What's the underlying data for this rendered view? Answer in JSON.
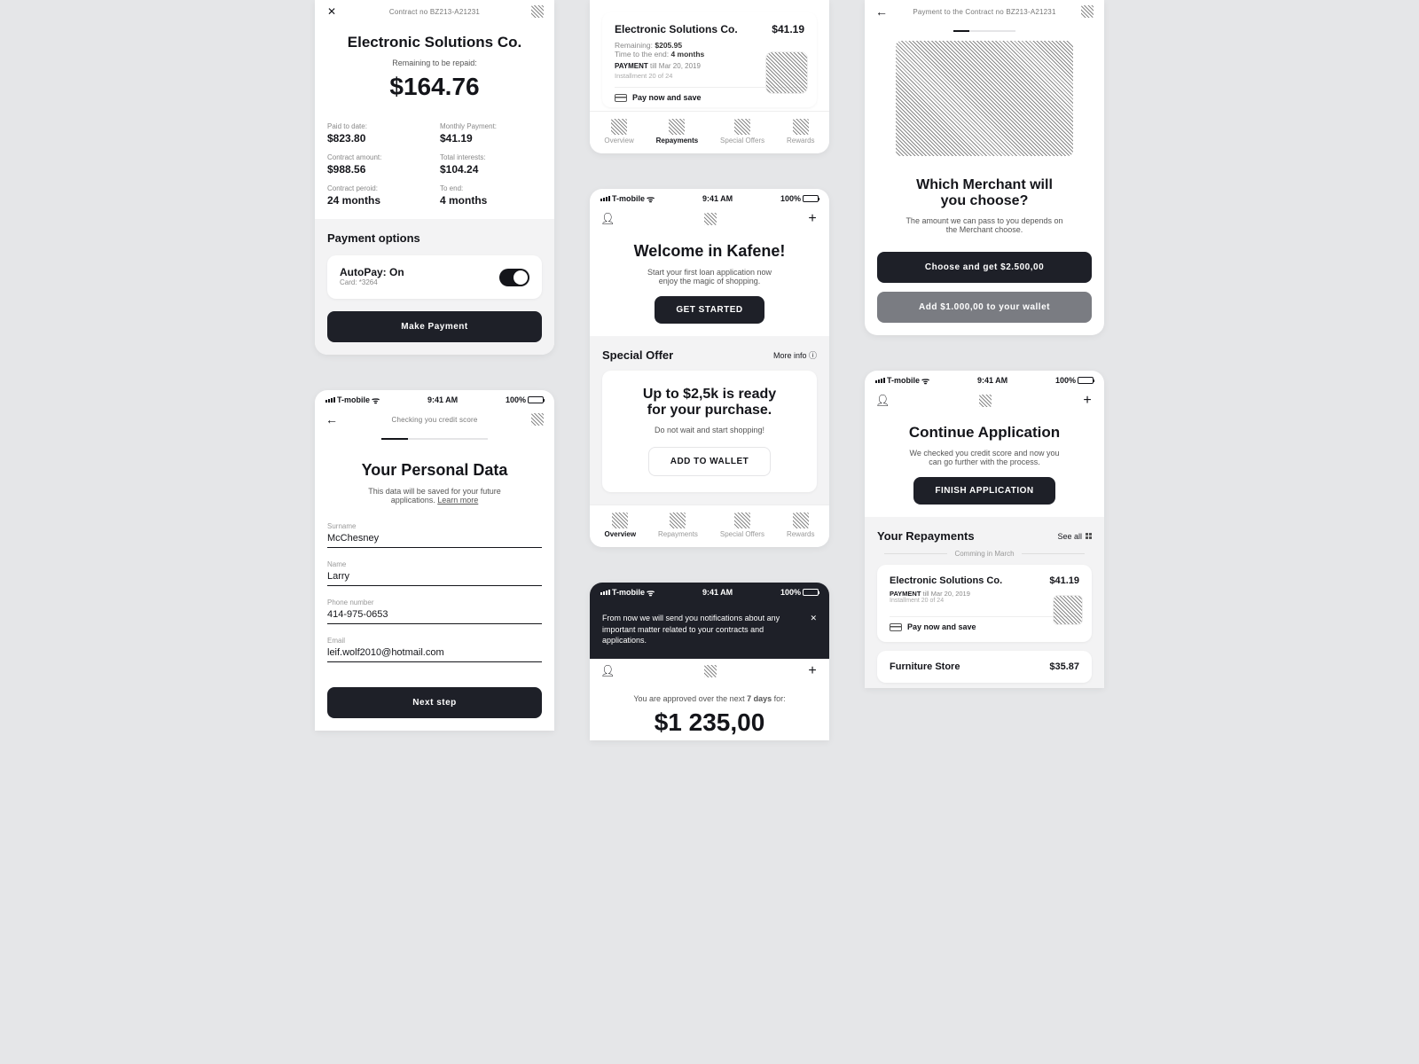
{
  "status": {
    "carrier": "T-mobile",
    "time": "9:41 AM",
    "battery": "100%"
  },
  "s1": {
    "contract_no": "Contract no BZ213-A21231",
    "company": "Electronic Solutions Co.",
    "remaining_label": "Remaining to be repaid:",
    "remaining": "$164.76",
    "stats": {
      "paid_label": "Paid to date:",
      "paid": "$823.80",
      "monthly_label": "Monthly Payment:",
      "monthly": "$41.19",
      "amount_label": "Contract amount:",
      "amount": "$988.56",
      "interest_label": "Total interests:",
      "interest": "$104.24",
      "period_label": "Contract peroid:",
      "period": "24 months",
      "toend_label": "To end:",
      "toend": "4 months"
    },
    "options_title": "Payment options",
    "autopay": "AutoPay: On",
    "card": "Card: *3264",
    "make_payment": "Make Payment"
  },
  "s2": {
    "topbar": "Checking you credit score",
    "title": "Your Personal Data",
    "sub_a": "This data will be saved for your future",
    "sub_b": "applications. ",
    "learn": "Learn more",
    "surname_l": "Surname",
    "surname": "McChesney",
    "name_l": "Name",
    "name": "Larry",
    "phone_l": "Phone number",
    "phone": "414-975-0653",
    "email_l": "Email",
    "email": "leif.wolf2010@hotmail.com",
    "next": "Next step"
  },
  "s3": {
    "company": "Electronic Solutions Co.",
    "amt": "$41.19",
    "rem": "Remaining: ",
    "rem_v": "$205.95",
    "tte": "Time to the end: ",
    "tte_v": "4 months",
    "pay": "PAYMENT ",
    "pay_v": "till Mar 20, 2019",
    "inst": "Installment 20 of 24",
    "paynow": "Pay now and save"
  },
  "tabs": {
    "overview": "Overview",
    "repay": "Repayments",
    "offers": "Special Offers",
    "rewards": "Rewards"
  },
  "s4": {
    "welcome": "Welcome in Kafene!",
    "l1": "Start your first loan application now",
    "l2": "enjoy the magic of shopping.",
    "get_started": "GET STARTED",
    "offer_title": "Special Offer",
    "more": "More info",
    "offer_h1": "Up to $2,5k is ready",
    "offer_h2": "for your purchase.",
    "offer_sub": "Do not wait and start shopping!",
    "add_wallet": "ADD TO WALLET"
  },
  "s5": {
    "noti": "From now we will send you notifications about any important matter related to your contracts and applications.",
    "approved_a": "You are approved over the next ",
    "days": "7 days",
    "approved_b": " for:",
    "amount": "$1 235,00"
  },
  "s6": {
    "top": "Payment to the Contract no BZ213-A21231",
    "title_a": "Which Merchant will",
    "title_b": "you choose?",
    "sub_a": "The amount we can pass to you depends on",
    "sub_b": "the Merchant choose.",
    "btn1": "Choose and get $2.500,00",
    "btn2": "Add $1.000,00 to your wallet"
  },
  "s7": {
    "title": "Continue Application",
    "sub_a": "We checked you credit score and now you",
    "sub_b": "can go further with the process.",
    "btn": "FINISH APPLICATION",
    "repay_title": "Your Repayments",
    "seeall": "See all",
    "coming": "Comming in March",
    "r1_title": "Electronic Solutions Co.",
    "r1_amt": "$41.19",
    "r1_pay": "PAYMENT ",
    "r1_till": "till Mar 20, 2019",
    "r1_inst": "Installment 20 of 24",
    "r1_paynow": "Pay now and save",
    "r2_title": "Furniture Store",
    "r2_amt": "$35.87"
  }
}
